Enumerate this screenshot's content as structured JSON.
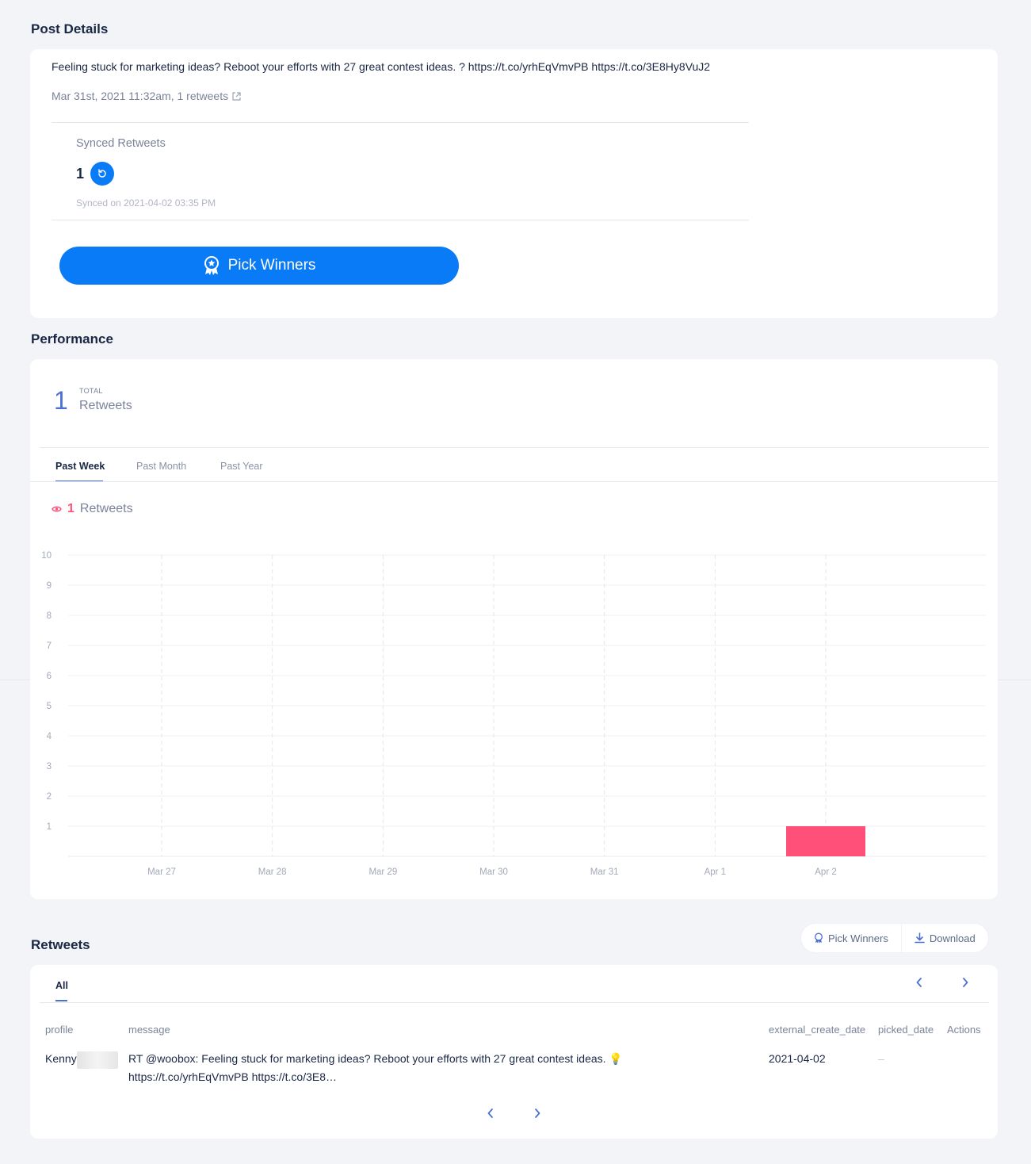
{
  "post_details": {
    "title": "Post Details",
    "text": "Feeling stuck for marketing ideas? Reboot your efforts with 27 great contest ideas. ? https://t.co/yrhEqVmvPB https://t.co/3E8Hy8VuJ2",
    "meta": "Mar 31st, 2021 11:32am, 1 retweets",
    "synced_label": "Synced Retweets",
    "synced_count": "1",
    "synced_on": "Synced on 2021-04-02 03:35 PM",
    "pick_winners_label": "Pick Winners"
  },
  "performance": {
    "title": "Performance",
    "total_value": "1",
    "total_caption": "TOTAL",
    "total_label": "Retweets",
    "tabs": [
      "Past Week",
      "Past Month",
      "Past Year"
    ],
    "active_tab": "Past Week",
    "legend_count": "1",
    "legend_label": "Retweets"
  },
  "chart_data": {
    "type": "bar",
    "categories": [
      "Mar 27",
      "Mar 28",
      "Mar 29",
      "Mar 30",
      "Mar 31",
      "Apr 1",
      "Apr 2"
    ],
    "series": [
      {
        "name": "Retweets",
        "values": [
          0,
          0,
          0,
          0,
          0,
          0,
          1
        ],
        "color": "#ff507a"
      }
    ],
    "yticks": [
      "1",
      "2",
      "3",
      "4",
      "5",
      "6",
      "7",
      "8",
      "9",
      "10"
    ],
    "ylim": [
      0,
      10
    ],
    "grid": true
  },
  "retweets": {
    "title": "Retweets",
    "pick_winners_label": "Pick Winners",
    "download_label": "Download",
    "tab_all": "All",
    "columns": [
      "profile",
      "message",
      "external_create_date",
      "picked_date",
      "Actions"
    ],
    "rows": [
      {
        "profile": "Kenny",
        "message_line1": "RT @woobox: Feeling stuck for marketing ideas? Reboot your efforts with 27 great contest ideas. 💡",
        "message_line2": "https://t.co/yrhEqVmvPB https://t.co/3E8…",
        "external_create_date": "2021-04-02",
        "picked_date": "–"
      }
    ]
  },
  "colors": {
    "accent": "#0a7bf7",
    "bar": "#ff507a",
    "tab_underline": "#4c6fd4",
    "navy": "#1a2744"
  }
}
